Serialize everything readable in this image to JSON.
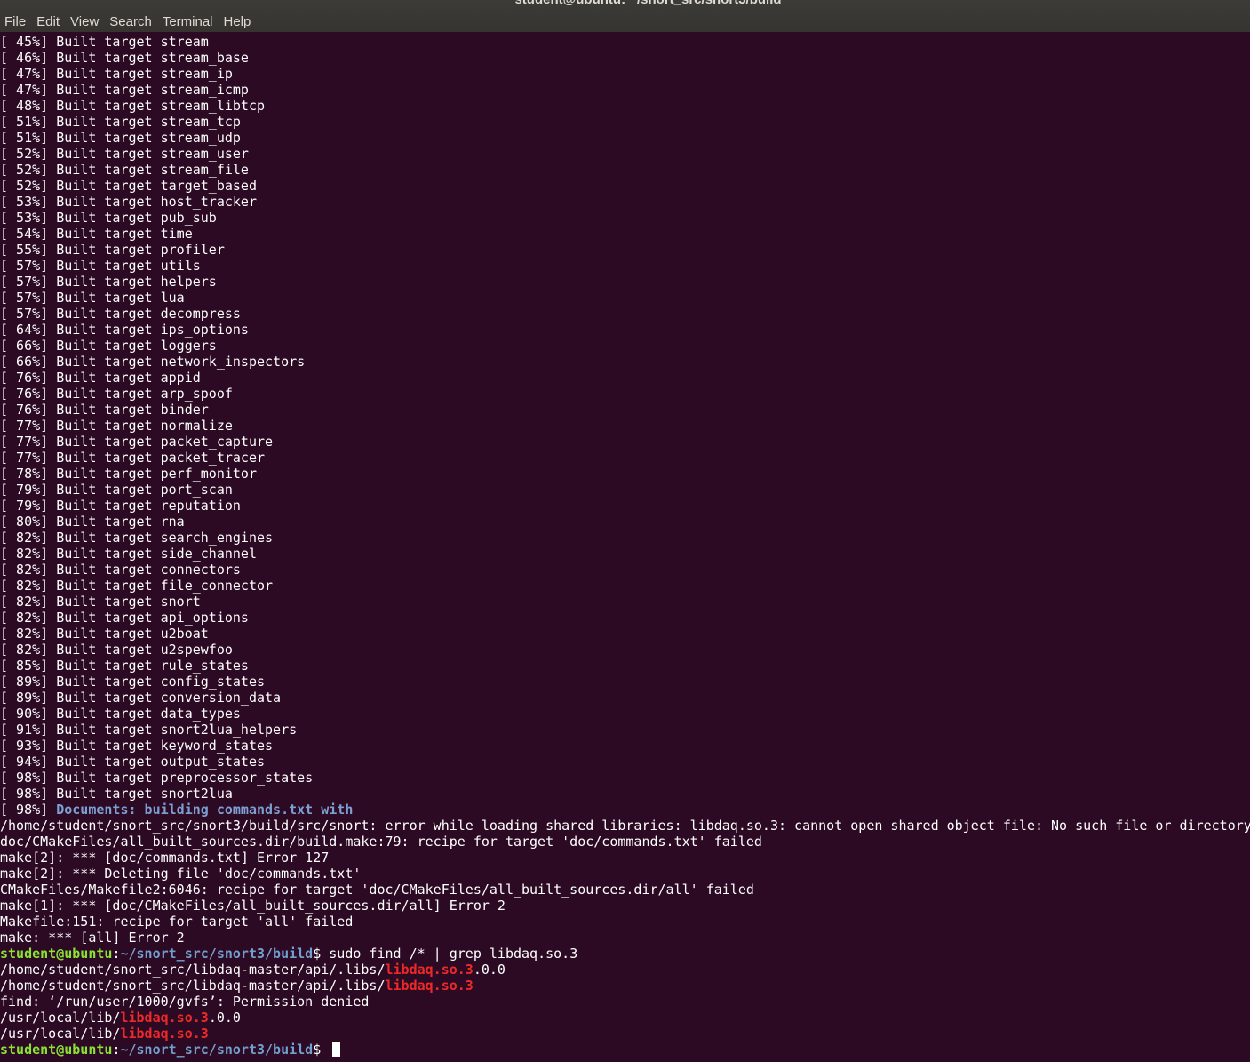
{
  "window": {
    "title": "student@ubuntu: ~/snort_src/snort3/build",
    "menu": [
      "File",
      "Edit",
      "View",
      "Search",
      "Terminal",
      "Help"
    ]
  },
  "colors": {
    "background": "#2c0a23",
    "prompt_user": "#8ae234",
    "prompt_path": "#729fcf",
    "highlight_match": "#ef2929",
    "progress_message": "#7d9fd3"
  },
  "terminal": {
    "lines": [
      [
        {
          "t": "[ 45%] Built target stream"
        }
      ],
      [
        {
          "t": "[ 46%] Built target stream_base"
        }
      ],
      [
        {
          "t": "[ 47%] Built target stream_ip"
        }
      ],
      [
        {
          "t": "[ 47%] Built target stream_icmp"
        }
      ],
      [
        {
          "t": "[ 48%] Built target stream_libtcp"
        }
      ],
      [
        {
          "t": "[ 51%] Built target stream_tcp"
        }
      ],
      [
        {
          "t": "[ 51%] Built target stream_udp"
        }
      ],
      [
        {
          "t": "[ 52%] Built target stream_user"
        }
      ],
      [
        {
          "t": "[ 52%] Built target stream_file"
        }
      ],
      [
        {
          "t": "[ 52%] Built target target_based"
        }
      ],
      [
        {
          "t": "[ 53%] Built target host_tracker"
        }
      ],
      [
        {
          "t": "[ 53%] Built target pub_sub"
        }
      ],
      [
        {
          "t": "[ 54%] Built target time"
        }
      ],
      [
        {
          "t": "[ 55%] Built target profiler"
        }
      ],
      [
        {
          "t": "[ 57%] Built target utils"
        }
      ],
      [
        {
          "t": "[ 57%] Built target helpers"
        }
      ],
      [
        {
          "t": "[ 57%] Built target lua"
        }
      ],
      [
        {
          "t": "[ 57%] Built target decompress"
        }
      ],
      [
        {
          "t": "[ 64%] Built target ips_options"
        }
      ],
      [
        {
          "t": "[ 66%] Built target loggers"
        }
      ],
      [
        {
          "t": "[ 66%] Built target network_inspectors"
        }
      ],
      [
        {
          "t": "[ 76%] Built target appid"
        }
      ],
      [
        {
          "t": "[ 76%] Built target arp_spoof"
        }
      ],
      [
        {
          "t": "[ 76%] Built target binder"
        }
      ],
      [
        {
          "t": "[ 77%] Built target normalize"
        }
      ],
      [
        {
          "t": "[ 77%] Built target packet_capture"
        }
      ],
      [
        {
          "t": "[ 77%] Built target packet_tracer"
        }
      ],
      [
        {
          "t": "[ 78%] Built target perf_monitor"
        }
      ],
      [
        {
          "t": "[ 79%] Built target port_scan"
        }
      ],
      [
        {
          "t": "[ 79%] Built target reputation"
        }
      ],
      [
        {
          "t": "[ 80%] Built target rna"
        }
      ],
      [
        {
          "t": "[ 82%] Built target search_engines"
        }
      ],
      [
        {
          "t": "[ 82%] Built target side_channel"
        }
      ],
      [
        {
          "t": "[ 82%] Built target connectors"
        }
      ],
      [
        {
          "t": "[ 82%] Built target file_connector"
        }
      ],
      [
        {
          "t": "[ 82%] Built target snort"
        }
      ],
      [
        {
          "t": "[ 82%] Built target api_options"
        }
      ],
      [
        {
          "t": "[ 82%] Built target u2boat"
        }
      ],
      [
        {
          "t": "[ 82%] Built target u2spewfoo"
        }
      ],
      [
        {
          "t": "[ 85%] Built target rule_states"
        }
      ],
      [
        {
          "t": "[ 89%] Built target config_states"
        }
      ],
      [
        {
          "t": "[ 89%] Built target conversion_data"
        }
      ],
      [
        {
          "t": "[ 90%] Built target data_types"
        }
      ],
      [
        {
          "t": "[ 91%] Built target snort2lua_helpers"
        }
      ],
      [
        {
          "t": "[ 93%] Built target keyword_states"
        }
      ],
      [
        {
          "t": "[ 94%] Built target output_states"
        }
      ],
      [
        {
          "t": "[ 98%] Built target preprocessor_states"
        }
      ],
      [
        {
          "t": "[ 98%] Built target snort2lua"
        }
      ],
      [
        {
          "t": "[ 98%] "
        },
        {
          "t": "Documents: building commands.txt with",
          "s": "blue"
        }
      ],
      [
        {
          "t": "/home/student/snort_src/snort3/build/src/snort: error while loading shared libraries: libdaq.so.3: cannot open shared object file: No such file or directory"
        }
      ],
      [
        {
          "t": "doc/CMakeFiles/all_built_sources.dir/build.make:79: recipe for target 'doc/commands.txt' failed"
        }
      ],
      [
        {
          "t": "make[2]: *** [doc/commands.txt] Error 127"
        }
      ],
      [
        {
          "t": "make[2]: *** Deleting file 'doc/commands.txt'"
        }
      ],
      [
        {
          "t": "CMakeFiles/Makefile2:6046: recipe for target 'doc/CMakeFiles/all_built_sources.dir/all' failed"
        }
      ],
      [
        {
          "t": "make[1]: *** [doc/CMakeFiles/all_built_sources.dir/all] Error 2"
        }
      ],
      [
        {
          "t": "Makefile:151: recipe for target 'all' failed"
        }
      ],
      [
        {
          "t": "make: *** [all] Error 2"
        }
      ],
      [
        {
          "t": "student@ubuntu",
          "s": "green"
        },
        {
          "t": ":"
        },
        {
          "t": "~/snort_src/snort3/build",
          "s": "path"
        },
        {
          "t": "$ sudo find /* | grep libdaq.so.3"
        }
      ],
      [
        {
          "t": "/home/student/snort_src/libdaq-master/api/.libs/"
        },
        {
          "t": "libdaq.so.3",
          "s": "red"
        },
        {
          "t": ".0.0"
        }
      ],
      [
        {
          "t": "/home/student/snort_src/libdaq-master/api/.libs/"
        },
        {
          "t": "libdaq.so.3",
          "s": "red"
        }
      ],
      [
        {
          "t": "find: ‘/run/user/1000/gvfs’: Permission denied"
        }
      ],
      [
        {
          "t": "/usr/local/lib/"
        },
        {
          "t": "libdaq.so.3",
          "s": "red"
        },
        {
          "t": ".0.0"
        }
      ],
      [
        {
          "t": "/usr/local/lib/"
        },
        {
          "t": "libdaq.so.3",
          "s": "red"
        }
      ],
      [
        {
          "t": "student@ubuntu",
          "s": "green"
        },
        {
          "t": ":"
        },
        {
          "t": "~/snort_src/snort3/build",
          "s": "path"
        },
        {
          "t": "$ "
        },
        {
          "t": "",
          "s": "cursor"
        }
      ]
    ]
  }
}
